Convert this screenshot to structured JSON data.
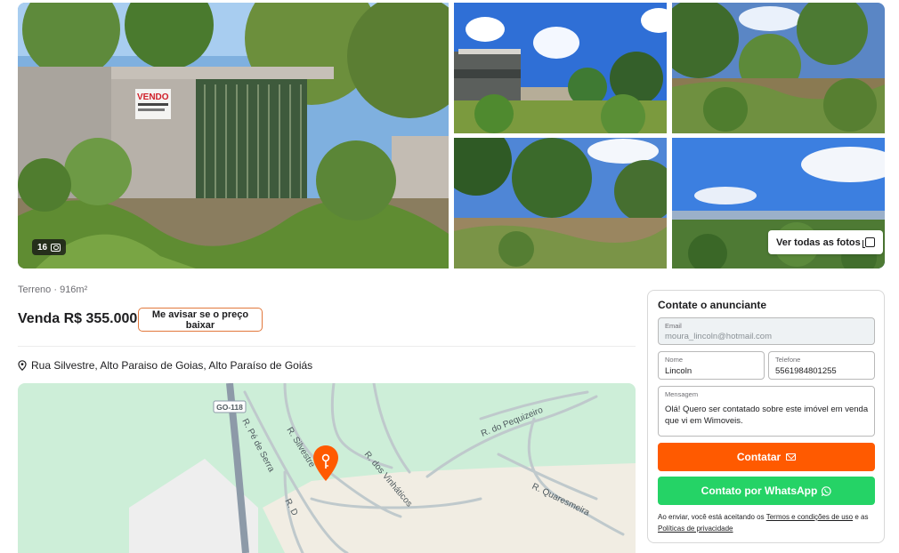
{
  "gallery": {
    "photo_count": "16",
    "view_all_label": "Ver todas as fotos",
    "sign_text": "VENDO"
  },
  "listing": {
    "property_type": "Terreno · 916m²",
    "price": "Venda R$ 355.000",
    "price_alert_label": "Me avisar se o preço baixar",
    "address": "Rua Silvestre, Alto Paraiso de Goias, Alto Paraíso de Goiás"
  },
  "map": {
    "highway_shield": "GO-118",
    "streets": {
      "pe_de_serra": "R. Pé de Serra",
      "silvestre": "R. Silvestre",
      "dos_vinhaticos": "R. dos Vinháticos",
      "do_pequizeiro": "R. do Pequizeiro",
      "quaresmeira": "R. Quaresmeira",
      "d": "R. D"
    }
  },
  "contact": {
    "title": "Contate o anunciante",
    "email_label": "Email",
    "email_value": "moura_lincoln@hotmail.com",
    "name_label": "Nome",
    "name_value": "Lincoln",
    "phone_label": "Telefone",
    "phone_value": "5561984801255",
    "message_label": "Mensagem",
    "message_value": "Olá! Quero ser contatado sobre este imóvel em venda que vi em Wimoveis.",
    "contact_button": "Contatar",
    "whatsapp_button": "Contato por WhatsApp",
    "terms_prefix": "Ao enviar, você está aceitando os",
    "terms_link": "Termos e condições de uso",
    "terms_middle": "e as",
    "privacy_link": "Políticas de privacidade"
  },
  "colors": {
    "accent": "#ff5a00",
    "whatsapp": "#25d366",
    "map_green": "#cdeed8",
    "map_land": "#f1ede3"
  },
  "icons": {
    "photo_count": "camera-icon",
    "view_all": "gallery-icon",
    "address": "location-pin-icon",
    "map_marker": "map-marker-icon",
    "contact": "mail-icon",
    "whatsapp": "whatsapp-icon"
  }
}
